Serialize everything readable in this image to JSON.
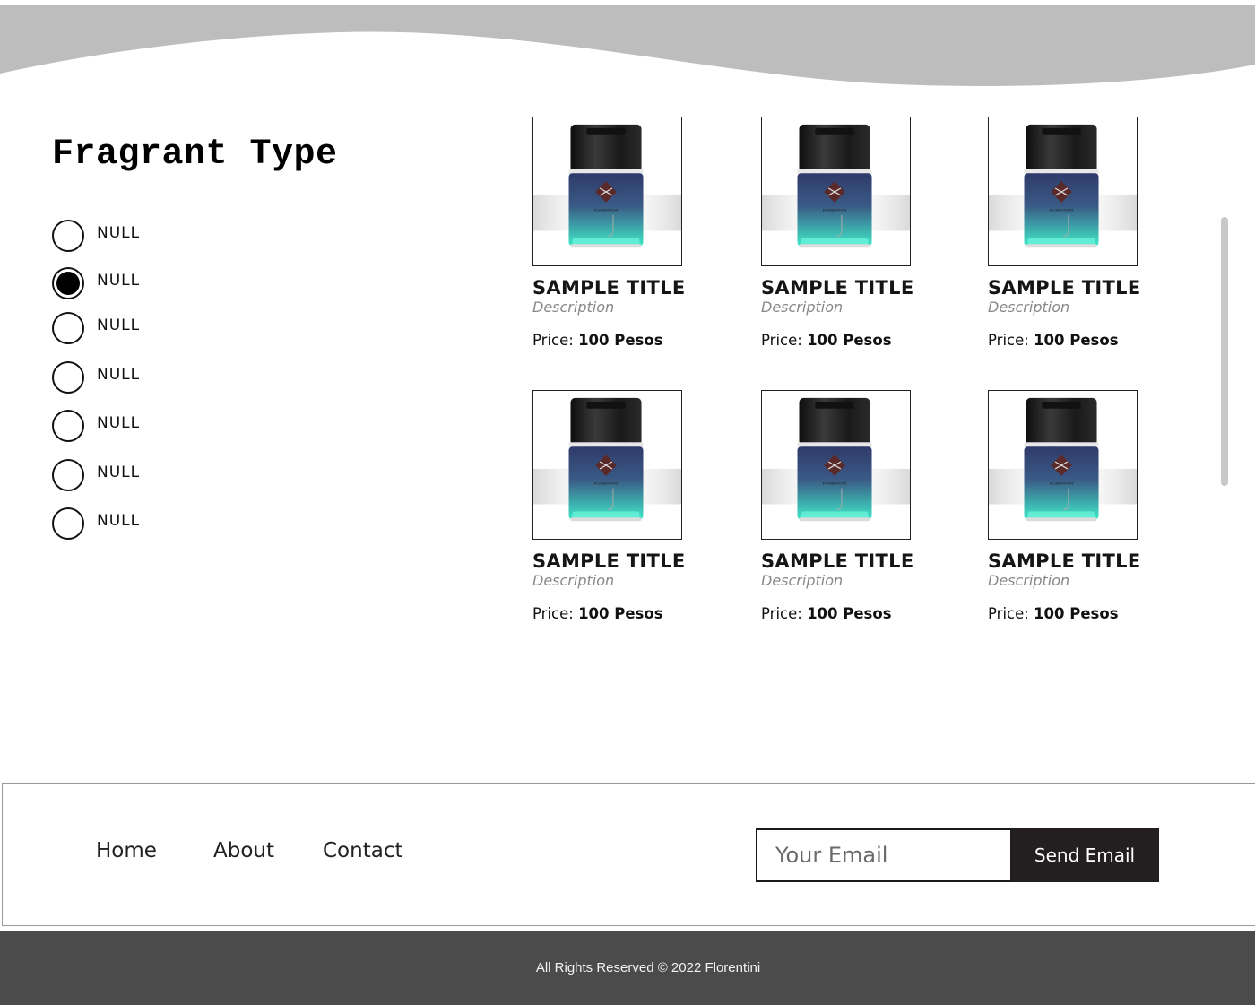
{
  "colors": {
    "wave": "#bdbdbd",
    "bottle_cap": "#1c1c1c",
    "bottle_top": "#2f3a6a",
    "bottle_bottom": "#3fe8c8",
    "button_bg": "#231f20",
    "copyright_bg": "#4b4b4b"
  },
  "filter": {
    "title": "Fragrant Type",
    "options": [
      {
        "label": "NULL",
        "checked": false
      },
      {
        "label": "NULL",
        "checked": true
      },
      {
        "label": "NULL",
        "checked": false
      },
      {
        "label": "NULL",
        "checked": false
      },
      {
        "label": "NULL",
        "checked": false
      },
      {
        "label": "NULL",
        "checked": false
      },
      {
        "label": "NULL",
        "checked": false
      }
    ]
  },
  "products": [
    {
      "title": "SAMPLE TITLE",
      "description": "Description",
      "price_label": "Price:",
      "price_value": "100 Pesos",
      "image": "perfume-bottle"
    },
    {
      "title": "SAMPLE TITLE",
      "description": "Description",
      "price_label": "Price:",
      "price_value": "100 Pesos",
      "image": "perfume-bottle"
    },
    {
      "title": "SAMPLE TITLE",
      "description": "Description",
      "price_label": "Price:",
      "price_value": "100 Pesos",
      "image": "perfume-bottle"
    },
    {
      "title": "SAMPLE TITLE",
      "description": "Description",
      "price_label": "Price:",
      "price_value": "100 Pesos",
      "image": "perfume-bottle"
    },
    {
      "title": "SAMPLE TITLE",
      "description": "Description",
      "price_label": "Price:",
      "price_value": "100 Pesos",
      "image": "perfume-bottle"
    },
    {
      "title": "SAMPLE TITLE",
      "description": "Description",
      "price_label": "Price:",
      "price_value": "100 Pesos",
      "image": "perfume-bottle"
    }
  ],
  "footer": {
    "nav": {
      "home": "Home",
      "about": "About",
      "contact": "Contact"
    },
    "email_placeholder": "Your Email",
    "send_label": "Send Email"
  },
  "copyright": "All Rights Reserved © 2022 Florentini"
}
